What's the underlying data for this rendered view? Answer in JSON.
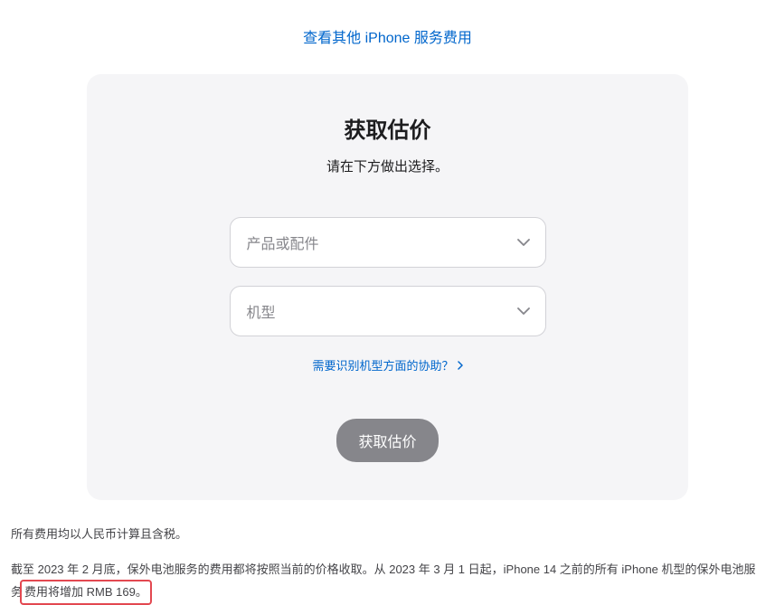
{
  "topLink": {
    "label": "查看其他 iPhone 服务费用"
  },
  "card": {
    "title": "获取估价",
    "subtitle": "请在下方做出选择。",
    "select1": {
      "placeholder": "产品或配件"
    },
    "select2": {
      "placeholder": "机型"
    },
    "helpLink": {
      "label": "需要识别机型方面的协助？"
    },
    "submitButton": {
      "label": "获取估价"
    }
  },
  "footer": {
    "line1": "所有费用均以人民币计算且含税。",
    "line2_a": "截至 2023 年 2 月底，保外电池服务的费用都将按照当前的价格收取。从 2023 年 3 月 1 日起，iPhone 14 之前的所有 iPhone 机型的保外电池服务",
    "line2_b": "费用将增加 RMB 169。"
  }
}
